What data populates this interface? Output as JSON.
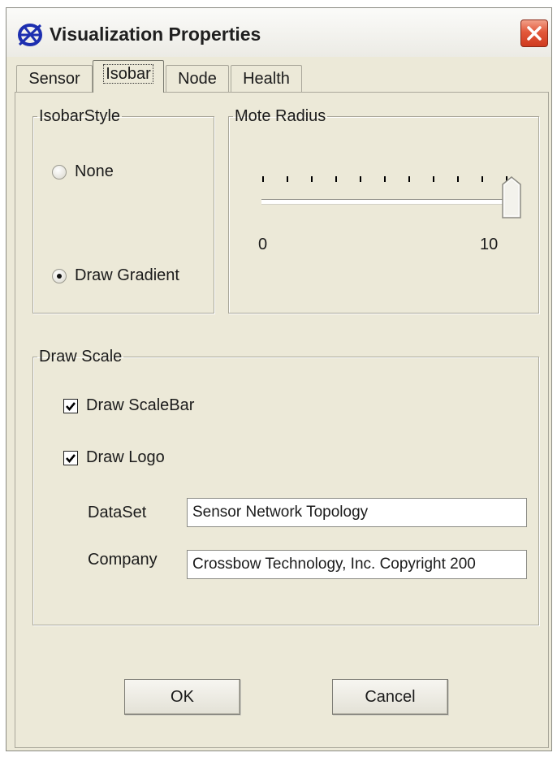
{
  "window": {
    "title": "Visualization Properties",
    "icon": "app-logo-icon",
    "close_icon": "close-icon",
    "close_color": "#d9472b"
  },
  "tabs": [
    {
      "label": "Sensor",
      "active": false
    },
    {
      "label": "Isobar",
      "active": true
    },
    {
      "label": "Node",
      "active": false
    },
    {
      "label": "Health",
      "active": false
    }
  ],
  "isobar_style": {
    "legend": "IsobarStyle",
    "options": [
      {
        "label": "None",
        "selected": false
      },
      {
        "label": "Draw Gradient",
        "selected": true
      }
    ]
  },
  "mote_radius": {
    "legend": "Mote Radius",
    "min_label": "0",
    "max_label": "10",
    "min": 0,
    "max": 10,
    "value": 10
  },
  "draw_scale": {
    "legend": "Draw Scale",
    "draw_scalebar": {
      "label": "Draw ScaleBar",
      "checked": true
    },
    "draw_logo": {
      "label": "Draw Logo",
      "checked": true
    },
    "dataset": {
      "label": "DataSet",
      "value": "Sensor Network Topology"
    },
    "company": {
      "label": "Company",
      "value": "Crossbow Technology, Inc. Copyright 200"
    }
  },
  "buttons": {
    "ok": "OK",
    "cancel": "Cancel"
  }
}
